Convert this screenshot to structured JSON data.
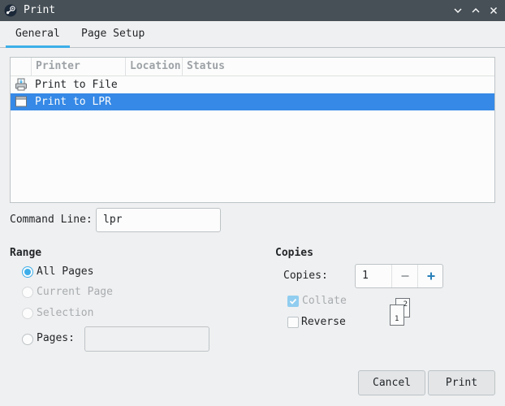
{
  "window": {
    "title": "Print"
  },
  "tabs": [
    {
      "label": "General",
      "active": true
    },
    {
      "label": "Page Setup",
      "active": false
    }
  ],
  "printer_list": {
    "columns": [
      "Printer",
      "Location",
      "Status"
    ],
    "rows": [
      {
        "name": "Print to File",
        "icon": "printer-file-icon",
        "selected": false
      },
      {
        "name": "Print to LPR",
        "icon": "printer-lpr-icon",
        "selected": true
      }
    ]
  },
  "command_line": {
    "label": "Command Line:",
    "value": "lpr"
  },
  "range": {
    "heading": "Range",
    "options": [
      {
        "label": "All Pages",
        "checked": true,
        "enabled": true
      },
      {
        "label": "Current Page",
        "checked": false,
        "enabled": false
      },
      {
        "label": "Selection",
        "checked": false,
        "enabled": false
      },
      {
        "label": "Pages:",
        "checked": false,
        "enabled": true
      }
    ],
    "pages_value": ""
  },
  "copies": {
    "heading": "Copies",
    "label": "Copies:",
    "value": "1",
    "collate": {
      "label": "Collate",
      "checked": true,
      "enabled": false
    },
    "reverse": {
      "label": "Reverse",
      "checked": false,
      "enabled": true
    },
    "page_icon_numbers": [
      "1",
      "2"
    ]
  },
  "buttons": {
    "cancel": "Cancel",
    "print": "Print"
  },
  "colors": {
    "accent": "#3daee9",
    "selection": "#3689e6",
    "titlebar": "#475057"
  }
}
